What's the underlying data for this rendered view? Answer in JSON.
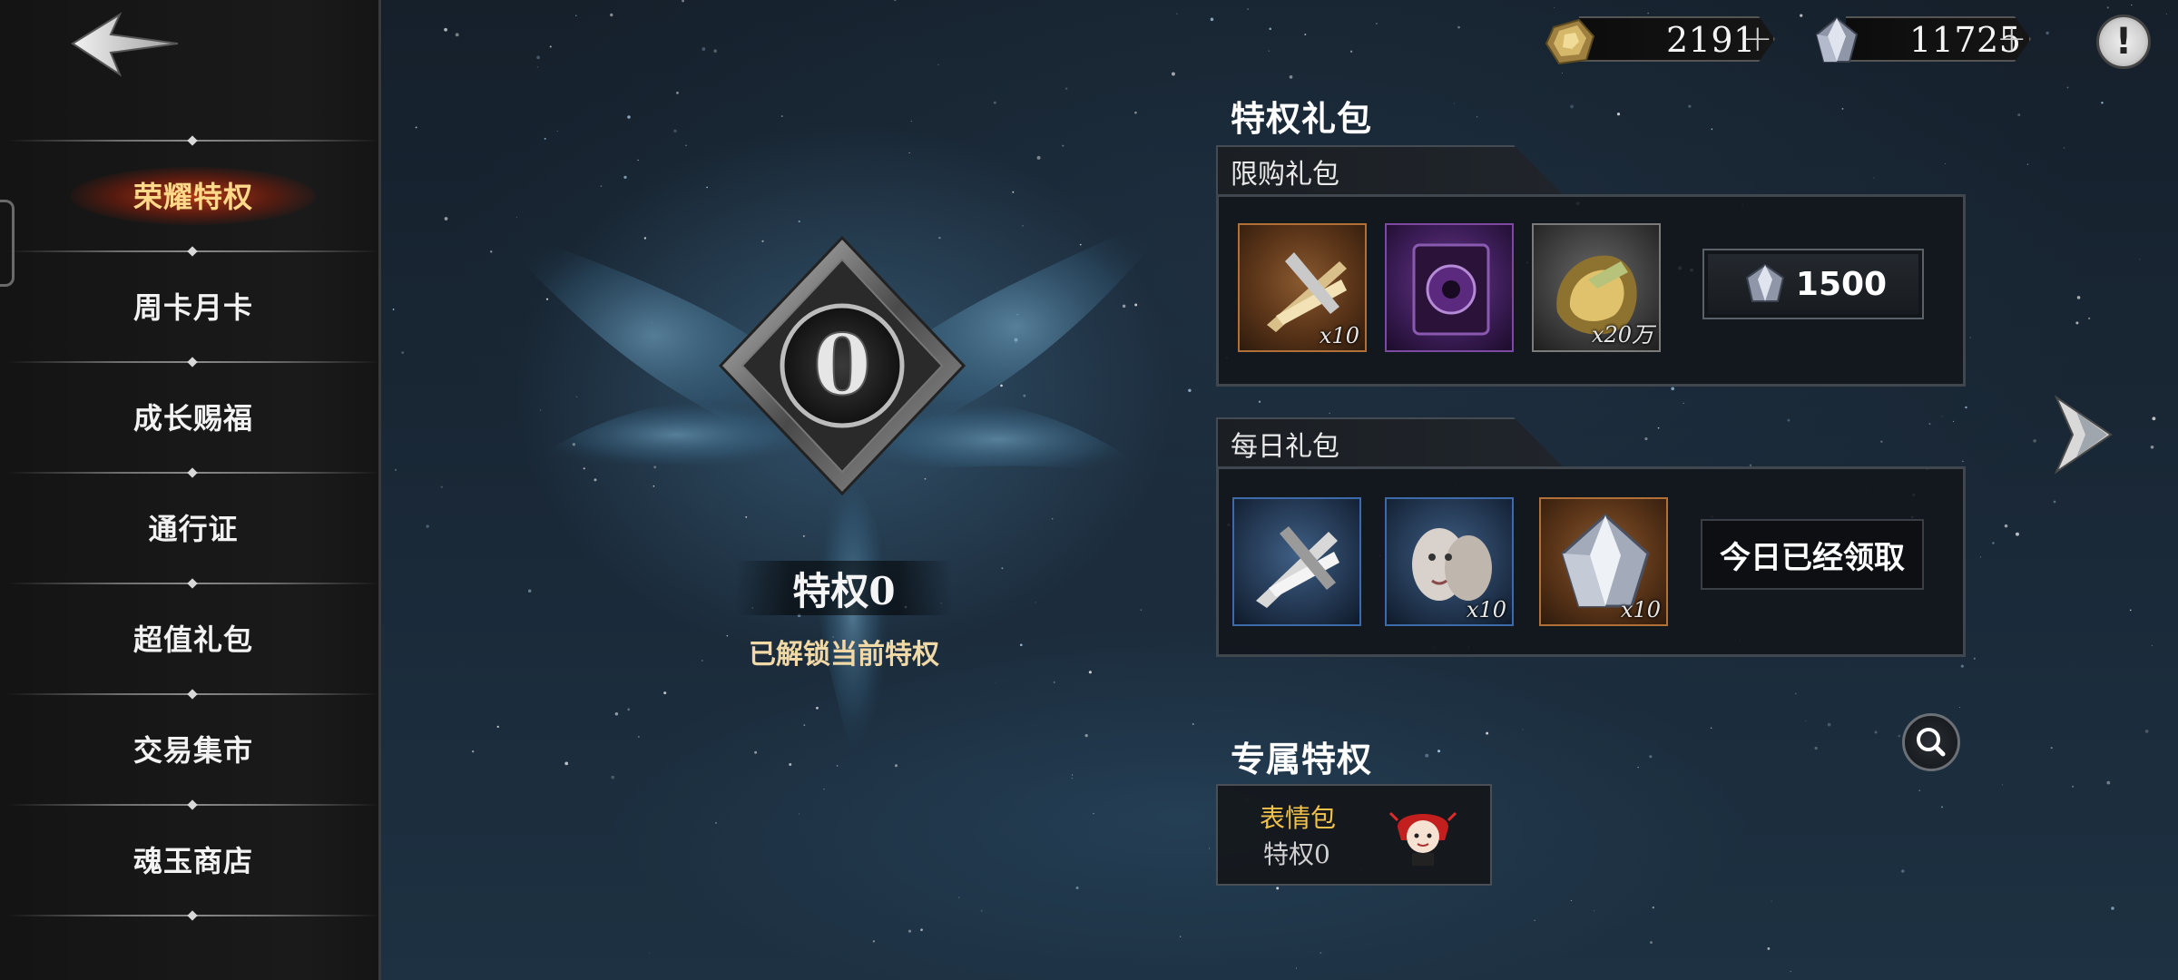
{
  "currencies": [
    {
      "icon": "gold-ore-icon",
      "value": "2191",
      "plus": "+"
    },
    {
      "icon": "crystal-icon",
      "value": "11725",
      "plus": "+"
    }
  ],
  "sidebar": {
    "items": [
      {
        "label": "荣耀特权",
        "active": true
      },
      {
        "label": "周卡月卡",
        "active": false
      },
      {
        "label": "成长赐福",
        "active": false
      },
      {
        "label": "通行证",
        "active": false
      },
      {
        "label": "超值礼包",
        "active": false
      },
      {
        "label": "交易集市",
        "active": false
      },
      {
        "label": "魂玉商店",
        "active": false
      }
    ]
  },
  "privilege": {
    "emblem_digit": "0",
    "title": "特权0",
    "subtitle": "已解锁当前特权"
  },
  "gift": {
    "section_title": "特权礼包",
    "limited": {
      "tab": "限购礼包",
      "items": [
        {
          "icon": "crossed-swords-icon",
          "rarity": "orange",
          "qty": "x10"
        },
        {
          "icon": "dark-tome-icon",
          "rarity": "purple",
          "qty": ""
        },
        {
          "icon": "gold-nugget-icon",
          "rarity": "grey",
          "qty": "x20万"
        }
      ],
      "price": "1500"
    },
    "daily": {
      "tab": "每日礼包",
      "items": [
        {
          "icon": "silver-swords-icon",
          "rarity": "blue",
          "qty": ""
        },
        {
          "icon": "mask-face-icon",
          "rarity": "blue",
          "qty": "x10"
        },
        {
          "icon": "silver-crystal-icon",
          "rarity": "orange",
          "qty": "x10"
        }
      ],
      "claimed_label": "今日已经领取"
    }
  },
  "exclusive": {
    "section_title": "专属特权",
    "card": {
      "name": "表情包",
      "level": "特权0"
    }
  },
  "colors": {
    "active_nav": "#ffd98a",
    "subtitle": "#f0d9a6",
    "emote_name": "#f2c24a",
    "rarity_orange": "#b07038",
    "rarity_purple": "#7d4aa3",
    "rarity_blue": "#3d6aa8"
  }
}
